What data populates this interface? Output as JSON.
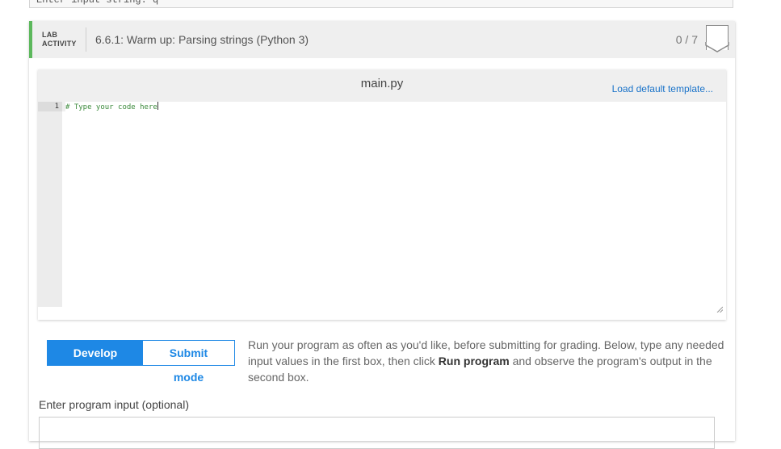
{
  "top_input": {
    "value": "Enter input string: q"
  },
  "lab": {
    "tag_line1": "LAB",
    "tag_line2": "ACTIVITY",
    "title": "6.6.1: Warm up: Parsing strings (Python 3)",
    "score": "0 / 7",
    "accent_color": "#5cb85c"
  },
  "editor": {
    "filename": "main.py",
    "load_template_label": "Load default template...",
    "lines": [
      {
        "number": "1",
        "code": "# Type your code here"
      }
    ]
  },
  "modes": {
    "develop_label": "Develop mode",
    "submit_label": "Submit mode",
    "active": "develop",
    "accent_color": "#1e88e5"
  },
  "instructions": {
    "part1": "Run your program as often as you'd like, before submitting for grading. Below, type any needed input values in the first box, then click ",
    "bold": "Run program",
    "part2": " and observe the program's output in the second box."
  },
  "program_input": {
    "label": "Enter program input (optional)",
    "value": ""
  }
}
